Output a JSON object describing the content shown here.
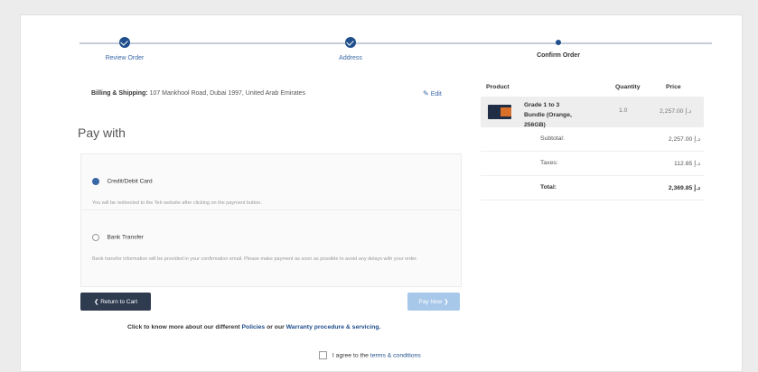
{
  "steps": [
    {
      "label": "Review Order"
    },
    {
      "label": "Address"
    },
    {
      "label": "Confirm Order"
    }
  ],
  "billing": {
    "label": "Billing & Shipping:",
    "address": "107 Mankhool Road, Dubai 1997, United Arab Emirates",
    "edit": "Edit"
  },
  "pay_title": "Pay with",
  "payment_options": [
    {
      "label": "Credit/Debit Card",
      "desc": "You will be redirected to the Telr website after clicking on the payment button.",
      "selected": true
    },
    {
      "label": "Bank Transfer",
      "desc": "Bank transfer information will be provided in your confirmation email. Please make payment as soon as possible to avoid any delays with your order.",
      "selected": false
    }
  ],
  "buttons": {
    "back": "❮ Return to Cart",
    "pay": "Pay Now ❯"
  },
  "info": {
    "prefix": "Click to know more about our different",
    "policies": "Policies",
    "middle": "or our",
    "warranty": "Warranty procedure & servicing."
  },
  "agree": {
    "prefix": "I agree to the",
    "link": "terms & conditions"
  },
  "summary": {
    "headers": {
      "product": "Product",
      "quantity": "Quantity",
      "price": "Price"
    },
    "product": {
      "name": "Grade 1 to 3 Bundle (Orange, 256GB)",
      "qty": "1.0",
      "price": "2,257.00 د.إ"
    },
    "rows": [
      {
        "label": "Subtotal:",
        "value": "2,257.00 د.إ"
      },
      {
        "label": "Taxes:",
        "value": "112.85 د.إ"
      },
      {
        "label": "Total:",
        "value": "2,369.85 د.إ"
      }
    ]
  },
  "colors": {
    "accent": "#1f4e8c",
    "dark_button": "#2f3b4f",
    "pay_button": "#a8c8ea"
  }
}
